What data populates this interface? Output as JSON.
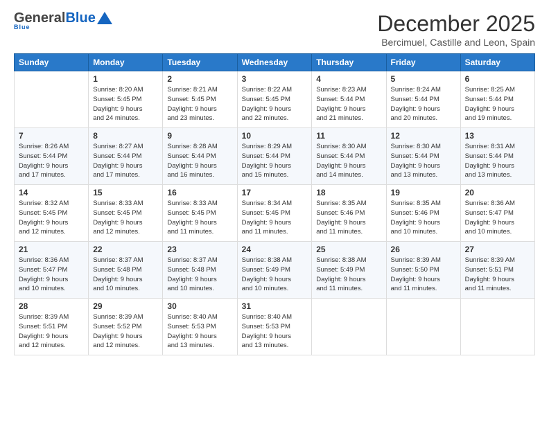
{
  "header": {
    "logo_general": "General",
    "logo_blue": "Blue",
    "title": "December 2025",
    "subtitle": "Bercimuel, Castille and Leon, Spain"
  },
  "weekdays": [
    "Sunday",
    "Monday",
    "Tuesday",
    "Wednesday",
    "Thursday",
    "Friday",
    "Saturday"
  ],
  "weeks": [
    [
      {
        "day": "",
        "info": ""
      },
      {
        "day": "1",
        "info": "Sunrise: 8:20 AM\nSunset: 5:45 PM\nDaylight: 9 hours\nand 24 minutes."
      },
      {
        "day": "2",
        "info": "Sunrise: 8:21 AM\nSunset: 5:45 PM\nDaylight: 9 hours\nand 23 minutes."
      },
      {
        "day": "3",
        "info": "Sunrise: 8:22 AM\nSunset: 5:45 PM\nDaylight: 9 hours\nand 22 minutes."
      },
      {
        "day": "4",
        "info": "Sunrise: 8:23 AM\nSunset: 5:44 PM\nDaylight: 9 hours\nand 21 minutes."
      },
      {
        "day": "5",
        "info": "Sunrise: 8:24 AM\nSunset: 5:44 PM\nDaylight: 9 hours\nand 20 minutes."
      },
      {
        "day": "6",
        "info": "Sunrise: 8:25 AM\nSunset: 5:44 PM\nDaylight: 9 hours\nand 19 minutes."
      }
    ],
    [
      {
        "day": "7",
        "info": "Sunrise: 8:26 AM\nSunset: 5:44 PM\nDaylight: 9 hours\nand 17 minutes."
      },
      {
        "day": "8",
        "info": "Sunrise: 8:27 AM\nSunset: 5:44 PM\nDaylight: 9 hours\nand 17 minutes."
      },
      {
        "day": "9",
        "info": "Sunrise: 8:28 AM\nSunset: 5:44 PM\nDaylight: 9 hours\nand 16 minutes."
      },
      {
        "day": "10",
        "info": "Sunrise: 8:29 AM\nSunset: 5:44 PM\nDaylight: 9 hours\nand 15 minutes."
      },
      {
        "day": "11",
        "info": "Sunrise: 8:30 AM\nSunset: 5:44 PM\nDaylight: 9 hours\nand 14 minutes."
      },
      {
        "day": "12",
        "info": "Sunrise: 8:30 AM\nSunset: 5:44 PM\nDaylight: 9 hours\nand 13 minutes."
      },
      {
        "day": "13",
        "info": "Sunrise: 8:31 AM\nSunset: 5:44 PM\nDaylight: 9 hours\nand 13 minutes."
      }
    ],
    [
      {
        "day": "14",
        "info": "Sunrise: 8:32 AM\nSunset: 5:45 PM\nDaylight: 9 hours\nand 12 minutes."
      },
      {
        "day": "15",
        "info": "Sunrise: 8:33 AM\nSunset: 5:45 PM\nDaylight: 9 hours\nand 12 minutes."
      },
      {
        "day": "16",
        "info": "Sunrise: 8:33 AM\nSunset: 5:45 PM\nDaylight: 9 hours\nand 11 minutes."
      },
      {
        "day": "17",
        "info": "Sunrise: 8:34 AM\nSunset: 5:45 PM\nDaylight: 9 hours\nand 11 minutes."
      },
      {
        "day": "18",
        "info": "Sunrise: 8:35 AM\nSunset: 5:46 PM\nDaylight: 9 hours\nand 11 minutes."
      },
      {
        "day": "19",
        "info": "Sunrise: 8:35 AM\nSunset: 5:46 PM\nDaylight: 9 hours\nand 10 minutes."
      },
      {
        "day": "20",
        "info": "Sunrise: 8:36 AM\nSunset: 5:47 PM\nDaylight: 9 hours\nand 10 minutes."
      }
    ],
    [
      {
        "day": "21",
        "info": "Sunrise: 8:36 AM\nSunset: 5:47 PM\nDaylight: 9 hours\nand 10 minutes."
      },
      {
        "day": "22",
        "info": "Sunrise: 8:37 AM\nSunset: 5:48 PM\nDaylight: 9 hours\nand 10 minutes."
      },
      {
        "day": "23",
        "info": "Sunrise: 8:37 AM\nSunset: 5:48 PM\nDaylight: 9 hours\nand 10 minutes."
      },
      {
        "day": "24",
        "info": "Sunrise: 8:38 AM\nSunset: 5:49 PM\nDaylight: 9 hours\nand 10 minutes."
      },
      {
        "day": "25",
        "info": "Sunrise: 8:38 AM\nSunset: 5:49 PM\nDaylight: 9 hours\nand 11 minutes."
      },
      {
        "day": "26",
        "info": "Sunrise: 8:39 AM\nSunset: 5:50 PM\nDaylight: 9 hours\nand 11 minutes."
      },
      {
        "day": "27",
        "info": "Sunrise: 8:39 AM\nSunset: 5:51 PM\nDaylight: 9 hours\nand 11 minutes."
      }
    ],
    [
      {
        "day": "28",
        "info": "Sunrise: 8:39 AM\nSunset: 5:51 PM\nDaylight: 9 hours\nand 12 minutes."
      },
      {
        "day": "29",
        "info": "Sunrise: 8:39 AM\nSunset: 5:52 PM\nDaylight: 9 hours\nand 12 minutes."
      },
      {
        "day": "30",
        "info": "Sunrise: 8:40 AM\nSunset: 5:53 PM\nDaylight: 9 hours\nand 13 minutes."
      },
      {
        "day": "31",
        "info": "Sunrise: 8:40 AM\nSunset: 5:53 PM\nDaylight: 9 hours\nand 13 minutes."
      },
      {
        "day": "",
        "info": ""
      },
      {
        "day": "",
        "info": ""
      },
      {
        "day": "",
        "info": ""
      }
    ]
  ]
}
